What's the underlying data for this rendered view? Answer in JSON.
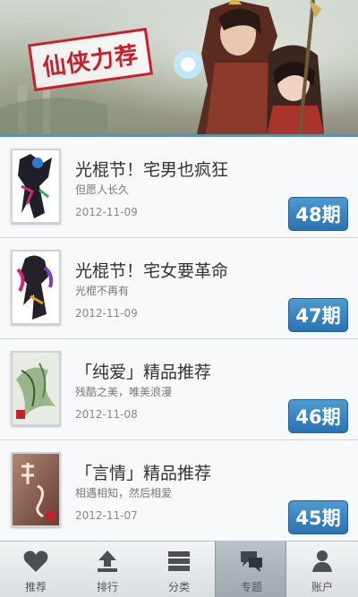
{
  "banner": {
    "stamp_text": "仙侠力荐"
  },
  "items": [
    {
      "title": "光棍节！宅男也疯狂",
      "subtitle": "但愿人长久",
      "date": "2012-11-09",
      "issue": "48期"
    },
    {
      "title": "光棍节！宅女要革命",
      "subtitle": "光棍不再有",
      "date": "2012-11-09",
      "issue": "47期"
    },
    {
      "title": "「纯爱」精品推荐",
      "subtitle": "残酷之美，唯美浪漫",
      "date": "2012-11-08",
      "issue": "46期"
    },
    {
      "title": "「言情」精品推荐",
      "subtitle": "相遇相知，然后相爱",
      "date": "2012-11-07",
      "issue": "45期"
    }
  ],
  "tabs": [
    {
      "label": "推荐",
      "icon": "heart-icon"
    },
    {
      "label": "排行",
      "icon": "upload-arrow-icon"
    },
    {
      "label": "分类",
      "icon": "stack-icon"
    },
    {
      "label": "专题",
      "icon": "chat-bubbles-icon",
      "active": true
    },
    {
      "label": "账户",
      "icon": "user-icon"
    }
  ],
  "colors": {
    "accent": "#2a73b3",
    "stamp_red": "#c8202a",
    "tabbar_active": "#9ea8ae"
  }
}
